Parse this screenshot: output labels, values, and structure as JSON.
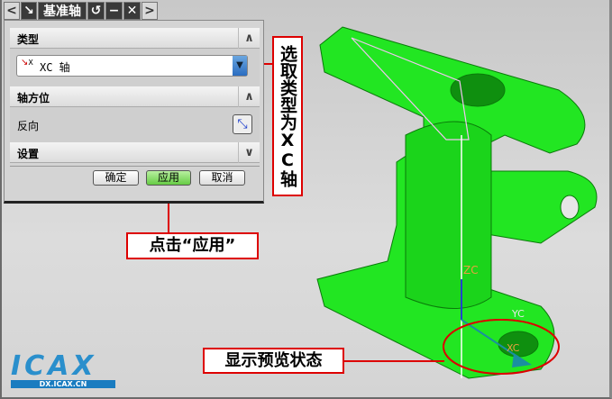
{
  "dialog": {
    "title": "基准轴",
    "sections": {
      "type": "类型",
      "orientation": "轴方位",
      "settings": "设置"
    },
    "type_value": "XC 轴",
    "type_icon_letter": "X",
    "reverse_label": "反向",
    "buttons": {
      "ok": "确定",
      "apply": "应用",
      "cancel": "取消"
    }
  },
  "annotations": {
    "select_type": "选取类型为XC轴",
    "click_apply": "点击“应用”",
    "preview": "显示预览状态"
  },
  "viewport": {
    "zc_label": "ZC",
    "xc_label": "XC",
    "yc_label": "YC"
  },
  "logo": {
    "text": "ICAX",
    "url_text": "DX.ICAX.CN"
  },
  "colors": {
    "part": "#22ee22",
    "annotation": "#dd0000",
    "apply": "#88dd66"
  }
}
